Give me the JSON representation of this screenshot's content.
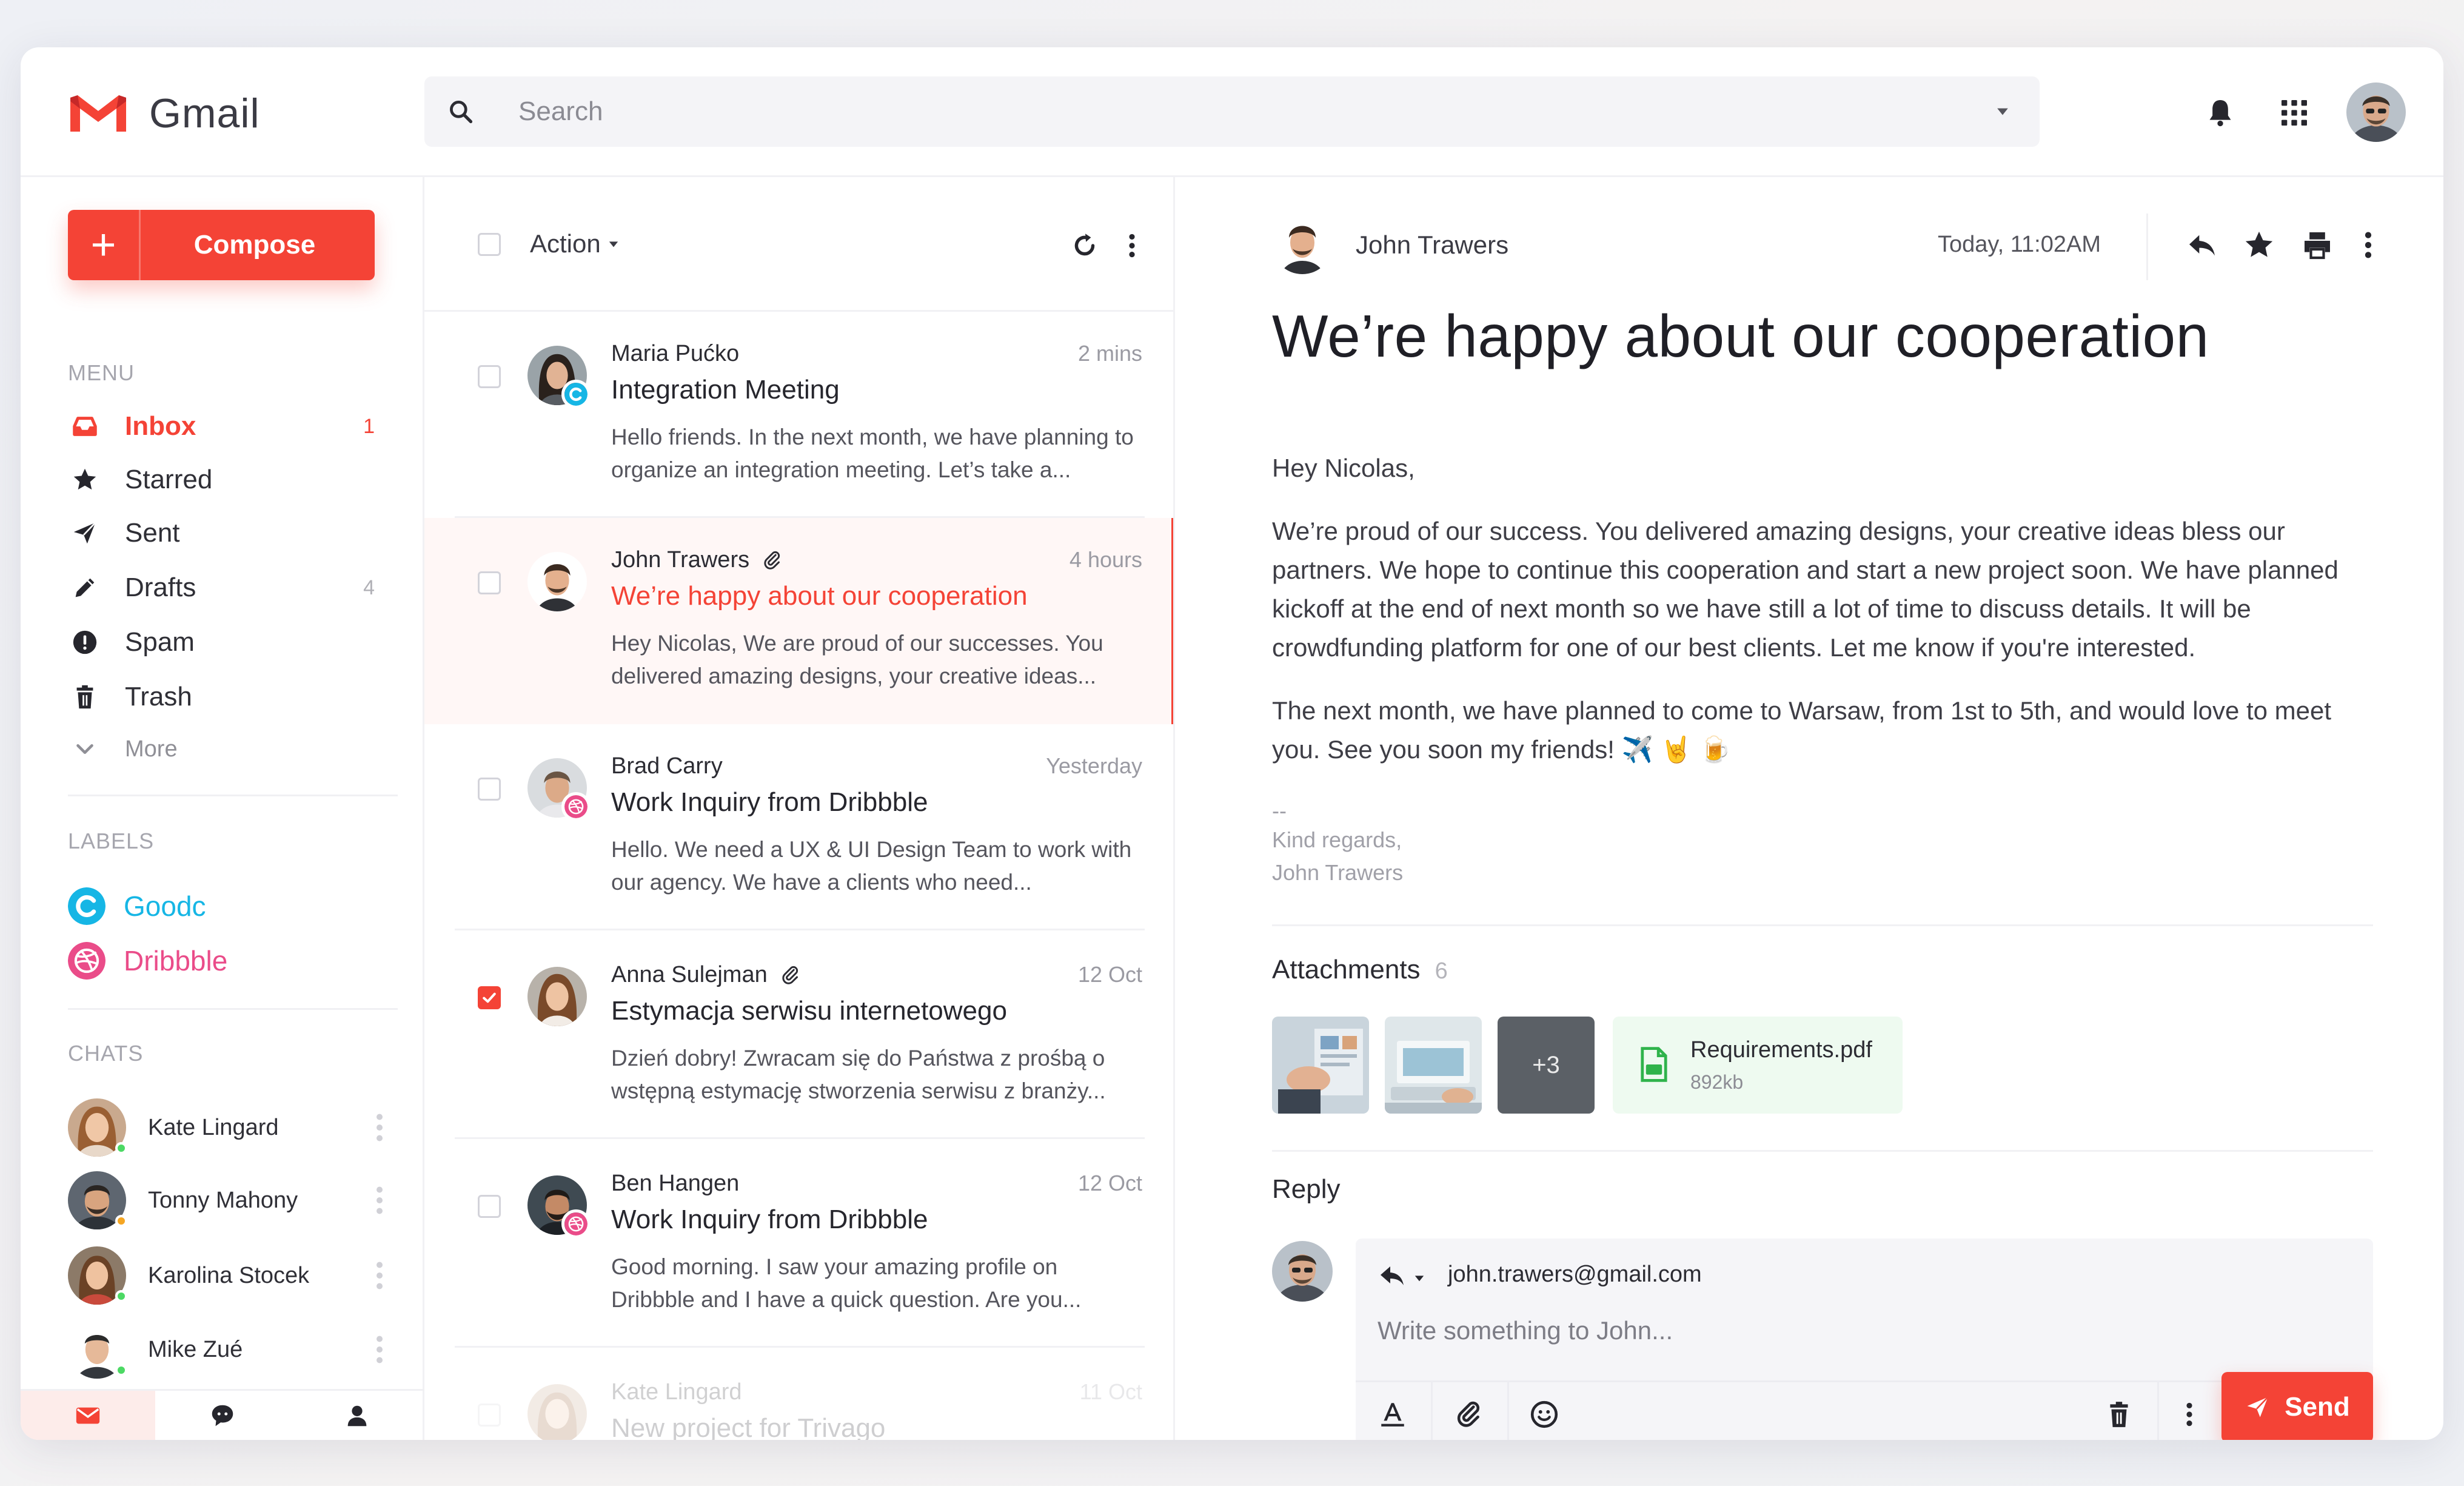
{
  "app": {
    "name": "Gmail"
  },
  "colors": {
    "accent": "#f44336",
    "goodc": "#16b6e5",
    "dribbble": "#ea4c89",
    "online": "#4cd964",
    "away": "#f5a623"
  },
  "search": {
    "placeholder": "Search"
  },
  "sidebar": {
    "compose_label": "Compose",
    "menu_title": "Menu",
    "menu": [
      {
        "label": "Inbox",
        "count": "1",
        "icon": "inbox-icon"
      },
      {
        "label": "Starred",
        "count": "",
        "icon": "star-icon"
      },
      {
        "label": "Sent",
        "count": "",
        "icon": "send-icon"
      },
      {
        "label": "Drafts",
        "count": "4",
        "icon": "pencil-icon"
      },
      {
        "label": "Spam",
        "count": "",
        "icon": "spam-icon"
      },
      {
        "label": "Trash",
        "count": "",
        "icon": "trash-icon"
      },
      {
        "label": "More",
        "count": "",
        "icon": "chevron-down-icon"
      }
    ],
    "labels_title": "Labels",
    "labels": [
      {
        "label": "Goodc",
        "color": "#16b6e5"
      },
      {
        "label": "Dribbble",
        "color": "#ea4c89"
      }
    ],
    "chats_title": "Chats",
    "chats": [
      {
        "name": "Kate Lingard",
        "status": "online"
      },
      {
        "name": "Tonny Mahony",
        "status": "away"
      },
      {
        "name": "Karolina Stocek",
        "status": "online"
      },
      {
        "name": "Mike Zué",
        "status": "online"
      }
    ]
  },
  "list": {
    "action_label": "Action",
    "mails": [
      {
        "from": "Maria Pućko",
        "time": "2 mins",
        "subject": "Integration Meeting",
        "preview": "Hello friends. In the next month, we have planning to organize an integration meeting. Let’s take a...",
        "attachment": false,
        "checked": false,
        "selected": false,
        "badge": "goodc"
      },
      {
        "from": "John Trawers",
        "time": "4 hours",
        "subject": "We’re happy about our cooperation",
        "preview": "Hey Nicolas, We are proud of our successes. You delivered amazing designs, your creative ideas...",
        "attachment": true,
        "checked": false,
        "selected": true,
        "badge": ""
      },
      {
        "from": "Brad Carry",
        "time": "Yesterday",
        "subject": "Work Inquiry from Dribbble",
        "preview": "Hello. We need a UX & UI Design Team to work with our agency. We have a clients who need...",
        "attachment": false,
        "checked": false,
        "selected": false,
        "badge": "dribbble"
      },
      {
        "from": "Anna Sulejman",
        "time": "12 Oct",
        "subject": "Estymacja serwisu internetowego",
        "preview": "Dzień dobry! Zwracam się do Państwa z prośbą o wstępną estymację stworzenia serwisu z branży...",
        "attachment": true,
        "checked": true,
        "selected": false,
        "badge": ""
      },
      {
        "from": "Ben Hangen",
        "time": "12 Oct",
        "subject": "Work Inquiry from Dribbble",
        "preview": "Good morning. I saw your amazing profile on Dribbble and I have a quick question. Are you...",
        "attachment": false,
        "checked": false,
        "selected": false,
        "badge": "dribbble"
      },
      {
        "from": "Kate Lingard",
        "time": "11 Oct",
        "subject": "New project for Trivago",
        "preview": "",
        "attachment": false,
        "checked": false,
        "selected": false,
        "badge": ""
      }
    ]
  },
  "read": {
    "sender": "John Trawers",
    "date": "Today, 11:02AM",
    "title": "We’re happy about our cooperation",
    "greeting": "Hey Nicolas,",
    "para1": "We’re proud of our success. You delivered amazing designs, your creative ideas bless our partners. We hope to continue this cooperation and start a new project soon. We have planned kickoff at the end of next month so we have still a lot of time to discuss details. It will be crowdfunding platform for one of our best clients. Let me know if you're interested.",
    "para2": "The next month, we have planned to come to Warsaw, from 1st to 5th, and would love to meet you. See you soon my friends! ✈️ 🤘 🍺",
    "sig_dash": "--",
    "sig_line1": "Kind regards,",
    "sig_line2": "John Trawers",
    "attachments_title": "Attachments",
    "attachments_count": "6",
    "more_thumbs": "+3",
    "pdf_name": "Requirements.pdf",
    "pdf_size": "892kb",
    "reply_title": "Reply",
    "reply_to": "john.trawers@gmail.com",
    "reply_placeholder": "Write something to John...",
    "send_label": "Send"
  }
}
